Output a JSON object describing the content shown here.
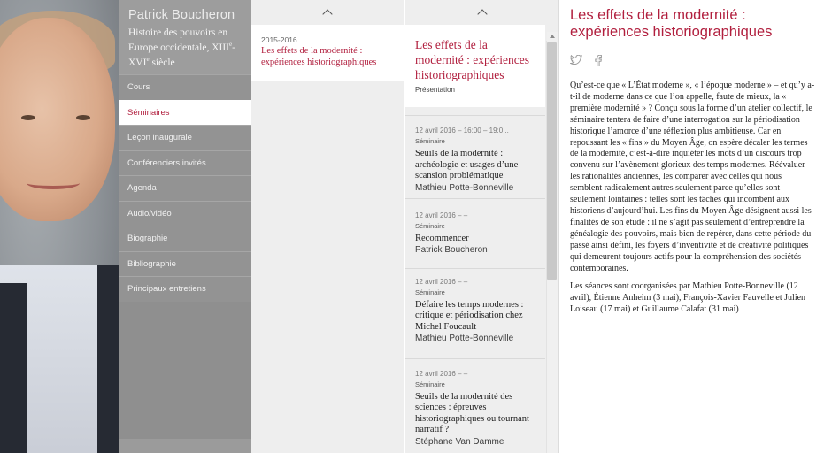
{
  "profile": {
    "name": "Patrick Boucheron",
    "chair_prefix": "Histoire des pouvoirs en Europe occidentale, XIII",
    "chair_sup1": "e",
    "chair_mid": "-XVI",
    "chair_sup2": "e",
    "chair_suffix": " siècle"
  },
  "nav": {
    "items": [
      {
        "label": "Cours"
      },
      {
        "label": "Séminaires"
      },
      {
        "label": "Leçon inaugurale"
      },
      {
        "label": "Conférenciers invités"
      },
      {
        "label": "Agenda"
      },
      {
        "label": "Audio/vidéo"
      },
      {
        "label": "Biographie"
      },
      {
        "label": "Bibliographie"
      },
      {
        "label": "Principaux entretiens"
      }
    ],
    "active_index": 1
  },
  "years": {
    "items": [
      {
        "year": "2015-2016",
        "title": "Les effets de la modernité : expériences historiographiques"
      }
    ]
  },
  "sessions": {
    "header": {
      "title": "Les effets de la modernité : expériences historiographiques",
      "kind": "Présentation"
    },
    "items": [
      {
        "date": "12 avril 2016  –  16:00  –  19:0...",
        "kind": "Séminaire",
        "title": "Seuils de la modernité : archéologie et usages d’une scansion problématique",
        "speaker": "Mathieu Potte-Bonneville"
      },
      {
        "date": "12 avril 2016  –    –",
        "kind": "Séminaire",
        "title": "Recommencer",
        "speaker": "Patrick Boucheron"
      },
      {
        "date": "12 avril 2016  –    –",
        "kind": "Séminaire",
        "title": "Défaire les temps modernes : critique et périodisation chez Michel Foucault",
        "speaker": "Mathieu Potte-Bonneville"
      },
      {
        "date": "12 avril 2016  –    –",
        "kind": "Séminaire",
        "title": "Seuils de la modernité des sciences : épreuves historiographiques ou tournant narratif ?",
        "speaker": "Stéphane Van Damme"
      }
    ]
  },
  "article": {
    "title": "Les effets de la modernité : expériences historiographiques",
    "paragraphs": [
      "Qu’est-ce que « L’État moderne », « l’époque moderne » – et qu’y a-t-il de moderne dans ce que l’on appelle, faute de mieux, la « première modernité » ? Conçu sous la forme d’un atelier collectif, le séminaire tentera de faire d’une interrogation sur la périodisation historique l’amorce d’une réflexion plus ambitieuse. Car en repoussant les « fins » du Moyen Âge, on espère décaler les termes de la modernité, c’est-à-dire inquiéter les mots d’un discours trop convenu sur l’avènement glorieux des temps modernes. Réévaluer les rationalités anciennes, les comparer avec celles qui nous semblent radicalement autres seulement parce qu’elles sont seulement lointaines : telles sont les tâches qui incombent aux historiens d’aujourd’hui. Les fins du Moyen Âge désignent aussi les finalités de son étude : il ne s’agit pas seulement d’entreprendre la généalogie des pouvoirs, mais bien de repérer, dans cette période du passé ainsi défini, les foyers d’inventivité et de créativité politiques qui demeurent toujours actifs pour la compréhension des sociétés contemporaines.",
      "Les séances sont coorganisées par Mathieu Potte-Bonneville (12 avril), Étienne Anheim (3 mai), François-Xavier Fauvelle et Julien Loiseau (17 mai) et Guillaume Calafat (31 mai)"
    ]
  },
  "icons": {
    "twitter": "twitter-icon",
    "facebook": "facebook-icon",
    "chevron": "chevron-up-icon"
  },
  "colors": {
    "accent": "#b11f3e",
    "nav_bg": "#939393",
    "column_bg": "#eeeeee"
  }
}
